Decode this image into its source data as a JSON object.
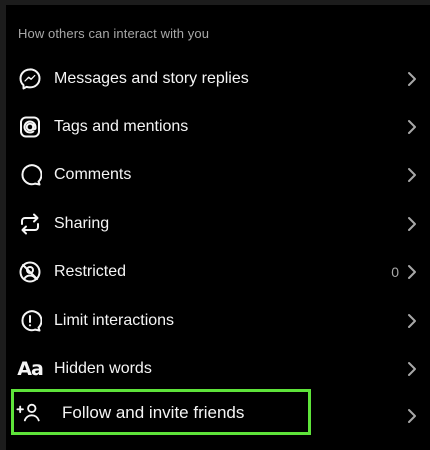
{
  "section": {
    "title": "How others can interact with you"
  },
  "items": [
    {
      "label": "Messages and story replies",
      "icon": "messenger-icon",
      "count": ""
    },
    {
      "label": "Tags and mentions",
      "icon": "at-sign-icon",
      "count": ""
    },
    {
      "label": "Comments",
      "icon": "comment-icon",
      "count": ""
    },
    {
      "label": "Sharing",
      "icon": "sharing-icon",
      "count": ""
    },
    {
      "label": "Restricted",
      "icon": "restricted-icon",
      "count": "0"
    },
    {
      "label": "Limit interactions",
      "icon": "limit-interactions-icon",
      "count": ""
    },
    {
      "label": "Hidden words",
      "icon": "hidden-words-icon",
      "count": "",
      "glyph": "Aa"
    },
    {
      "label": "Follow and invite friends",
      "icon": "add-person-icon",
      "count": ""
    }
  ],
  "colors": {
    "background": "#000000",
    "text": "#f5f5f5",
    "muted": "#a8a8a8",
    "highlight": "#5ee33a"
  }
}
